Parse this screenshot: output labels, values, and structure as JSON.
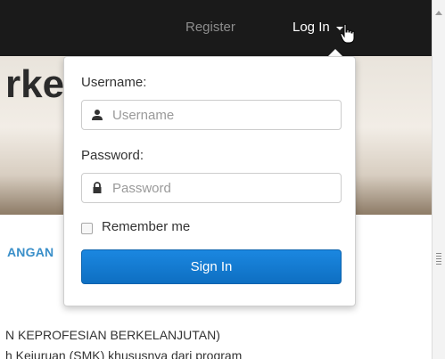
{
  "navbar": {
    "register_label": "Register",
    "login_label": "Log In",
    "caret_icon": "caret-down-icon",
    "cursor_icon": "hand-pointer-icon"
  },
  "page": {
    "hero_title_fragment": "rke",
    "section_heading_fragment": "ANGAN",
    "body_line_1": "N KEPROFESIAN BERKELANJUTAN)",
    "body_line_2": "h Kejuruan (SMK) khususnya dari program"
  },
  "login_dropdown": {
    "username_label": "Username:",
    "username_placeholder": "Username",
    "username_value": "",
    "username_icon": "user-icon",
    "password_label": "Password:",
    "password_placeholder": "Password",
    "password_value": "",
    "password_icon": "lock-icon",
    "remember_label": "Remember me",
    "remember_checked": false,
    "signin_label": "Sign In"
  },
  "colors": {
    "navbar_bg": "#1a1a1a",
    "signin_button": "#1478d2",
    "heading_accent": "#3a8fc9"
  }
}
